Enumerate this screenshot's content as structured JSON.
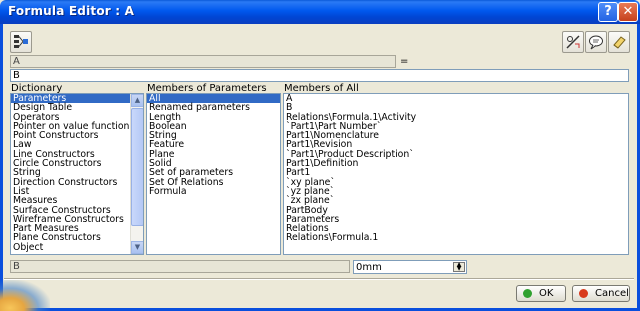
{
  "window": {
    "title": "Formula Editor : A",
    "help_label": "?",
    "close_label": "✕"
  },
  "toolbar": {
    "left_icon": "formula-tree-icon",
    "right_icons": [
      "measure-item-icon",
      "comment-bubble-icon",
      "eraser-icon"
    ]
  },
  "parameter_row": {
    "name": "A",
    "equals": "="
  },
  "formula_input": {
    "value": "B"
  },
  "columns": {
    "dictionary": "Dictionary",
    "members_of_parameters": "Members of Parameters",
    "members_of_all": "Members of All"
  },
  "dictionary_items": [
    "Parameters",
    "Design Table",
    "Operators",
    "Pointer on value functions",
    "Point Constructors",
    "Law",
    "Line Constructors",
    "Circle Constructors",
    "String",
    "Direction Constructors",
    "List",
    "Measures",
    "Surface Constructors",
    "Wireframe Constructors",
    "Part Measures",
    "Plane Constructors",
    "Object"
  ],
  "members_of_parameters_items": [
    "All",
    "Renamed parameters",
    "Length",
    "Boolean",
    "String",
    "Feature",
    "Plane",
    "Solid",
    "Set of parameters",
    "Set Of Relations",
    "Formula"
  ],
  "members_of_all_items": [
    "A",
    "B",
    "Relations\\Formula.1\\Activity",
    "`Part1\\Part Number`",
    "Part1\\Nomenclature",
    "Part1\\Revision",
    "`Part1\\Product Description`",
    "Part1\\Definition",
    "Part1",
    "`xy plane`",
    "`yz plane`",
    "`zx plane`",
    "PartBody",
    "Parameters",
    "Relations",
    "Relations\\Formula.1"
  ],
  "bottom_row": {
    "selected_param": "B",
    "value": "0mm"
  },
  "buttons": {
    "ok": "OK",
    "cancel": "Cancel"
  },
  "colors": {
    "selection": "#316ac5",
    "titlebar": "#0058ee",
    "ok_dot": "#2fa12f",
    "cancel_dot": "#d83a1c"
  }
}
